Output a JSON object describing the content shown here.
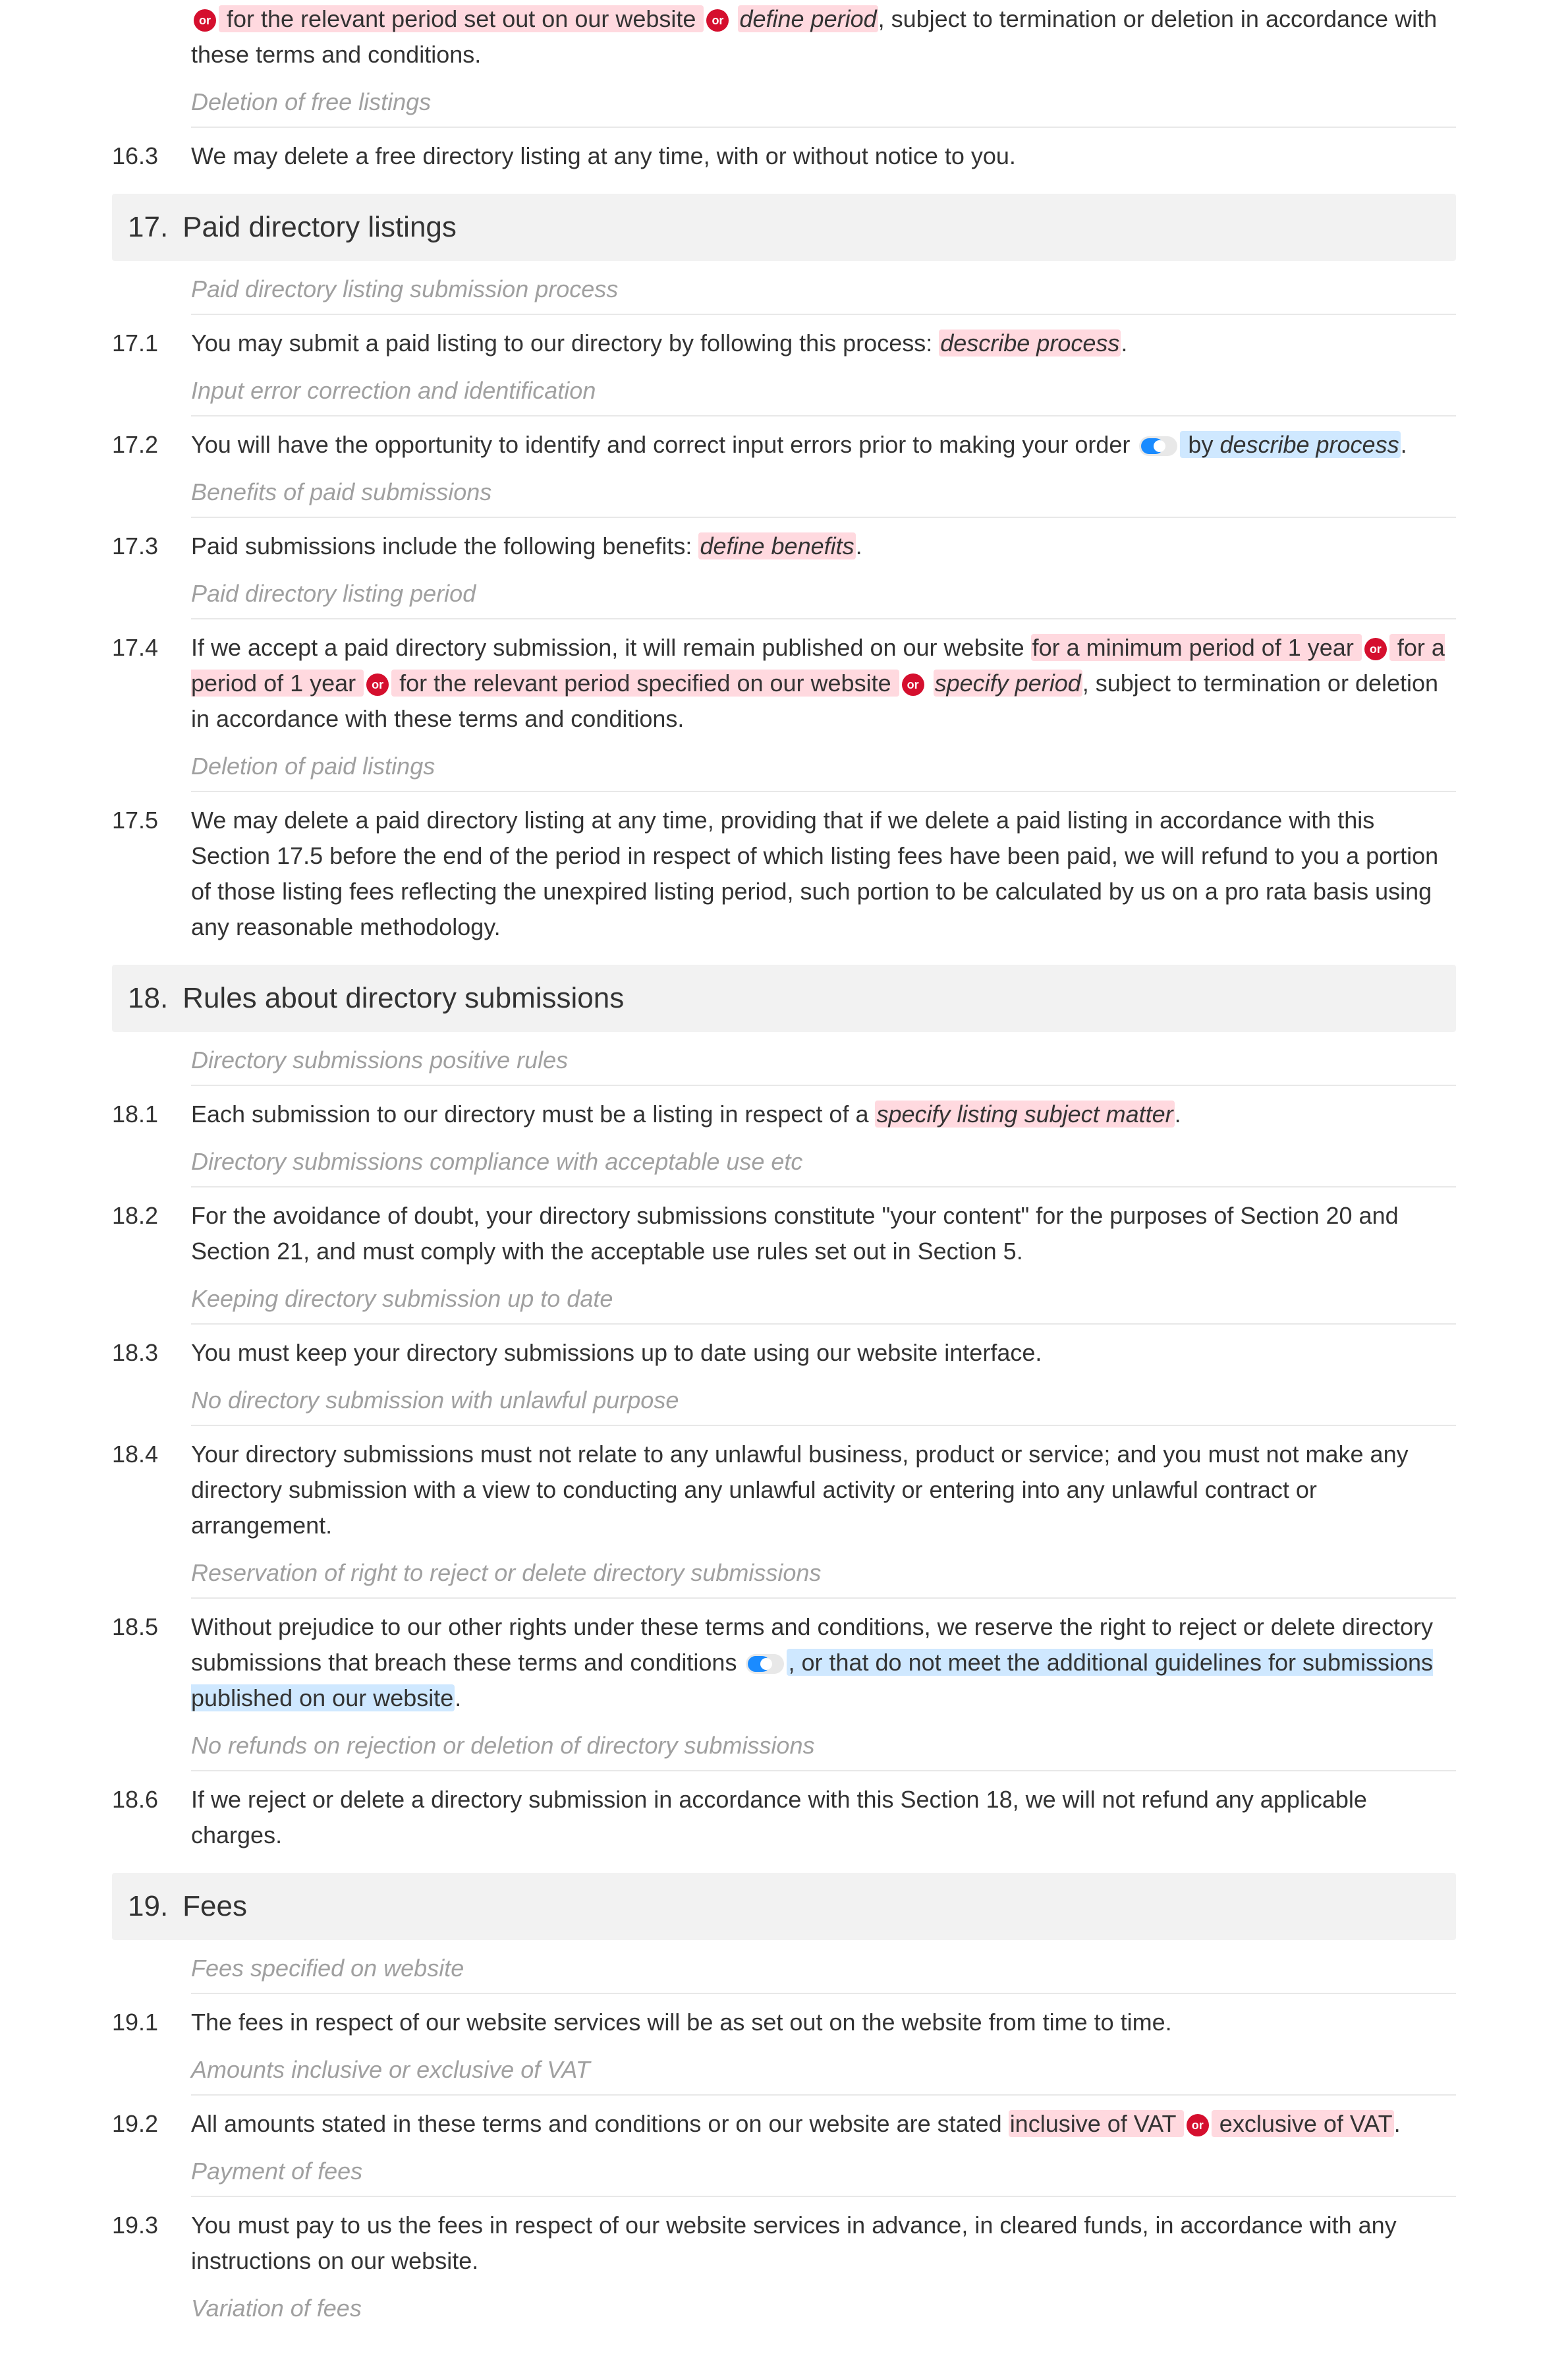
{
  "badges": {
    "or": "or"
  },
  "clause_16_frag": {
    "num": "",
    "pre_or": "",
    "hl1": " for the relevant period set out on our website ",
    "fill1": "define period",
    "post": ", subject to termination or deletion in accordance with these terms and conditions."
  },
  "sub_16_del": "Deletion of free listings",
  "c16_3": {
    "num": "16.3",
    "text": "We may delete a free directory listing at any time, with or without notice to you."
  },
  "sec17": {
    "num": "17.",
    "title": "Paid directory listings"
  },
  "sub_17_1h": "Paid directory listing submission process",
  "c17_1": {
    "num": "17.1",
    "pre": "You may submit a paid listing to our directory by following this process: ",
    "fill": "describe process",
    "post": "."
  },
  "sub_17_2h": "Input error correction and identification",
  "c17_2": {
    "num": "17.2",
    "pre": "You will have the opportunity to identify and correct input errors prior to making your order ",
    "blue_by": " by ",
    "fill": "describe process",
    "post": "."
  },
  "sub_17_3h": "Benefits of paid submissions",
  "c17_3": {
    "num": "17.3",
    "pre": "Paid submissions include the following benefits: ",
    "fill": "define benefits",
    "post": "."
  },
  "sub_17_4h": "Paid directory listing period",
  "c17_4": {
    "num": "17.4",
    "pre": "If we accept a paid directory submission, it will remain published on our website ",
    "hl1": "for a minimum period of 1 year ",
    "hl2": " for a period of 1 year ",
    "hl3": " for the relevant period specified on our website ",
    "fill": "specify period",
    "post": ", subject to termination or deletion in accordance with these terms and conditions."
  },
  "sub_17_5h": "Deletion of paid listings",
  "c17_5": {
    "num": "17.5",
    "text": "We may delete a paid directory listing at any time, providing that if we delete a paid listing in accordance with this Section 17.5 before the end of the period in respect of which listing fees have been paid, we will refund to you a portion of those listing fees reflecting the unexpired listing period, such portion to be calculated by us on a pro rata basis using any reasonable methodology."
  },
  "sec18": {
    "num": "18.",
    "title": "Rules about directory submissions"
  },
  "sub_18_1h": "Directory submissions positive rules",
  "c18_1": {
    "num": "18.1",
    "pre": "Each submission to our directory must be a listing in respect of a ",
    "fill": "specify listing subject matter",
    "post": "."
  },
  "sub_18_2h": "Directory submissions compliance with acceptable use etc",
  "c18_2": {
    "num": "18.2",
    "text": "For the avoidance of doubt, your directory submissions constitute \"your content\" for the purposes of Section 20 and Section 21, and must comply with the acceptable use rules set out in Section 5."
  },
  "sub_18_3h": "Keeping directory submission up to date",
  "c18_3": {
    "num": "18.3",
    "text": "You must keep your directory submissions up to date using our website interface."
  },
  "sub_18_4h": "No directory submission with unlawful purpose",
  "c18_4": {
    "num": "18.4",
    "text": "Your directory submissions must not relate to any unlawful business, product or service; and you must not make any directory submission with a view to conducting any unlawful activity or entering into any unlawful contract or arrangement."
  },
  "sub_18_5h": "Reservation of right to reject or delete directory submissions",
  "c18_5": {
    "num": "18.5",
    "pre": "Without prejudice to our other rights under these terms and conditions, we reserve the right to reject or delete directory submissions that breach these terms and conditions ",
    "blue": ", or that do not meet the additional guidelines for submissions published on our website",
    "post": "."
  },
  "sub_18_6h": "No refunds on rejection or deletion of directory submissions",
  "c18_6": {
    "num": "18.6",
    "text": "If we reject or delete a directory submission in accordance with this Section 18, we will not refund any applicable charges."
  },
  "sec19": {
    "num": "19.",
    "title": "Fees"
  },
  "sub_19_1h": "Fees specified on website",
  "c19_1": {
    "num": "19.1",
    "text": "The fees in respect of our website services will be as set out on the website from time to time."
  },
  "sub_19_2h": "Amounts inclusive or exclusive of VAT",
  "c19_2": {
    "num": "19.2",
    "pre": "All amounts stated in these terms and conditions or on our website are stated ",
    "hl1": "inclusive of VAT ",
    "hl2": " exclusive of VAT",
    "post": "."
  },
  "sub_19_3h": "Payment of fees",
  "c19_3": {
    "num": "19.3",
    "text": "You must pay to us the fees in respect of our website services in advance, in cleared funds, in accordance with any instructions on our website."
  },
  "sub_19_4h": "Variation of fees"
}
